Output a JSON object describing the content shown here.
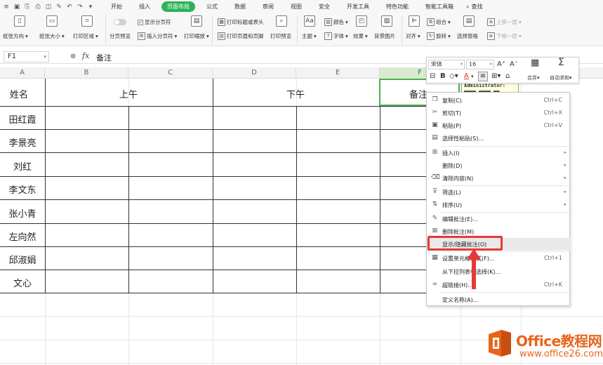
{
  "tabs": {
    "items": [
      "开始",
      "插入",
      "页面布局",
      "公式",
      "数据",
      "审阅",
      "视图",
      "安全",
      "开发工具",
      "特色功能",
      "智能工具箱"
    ],
    "active": "页面布局",
    "search_label": "查找"
  },
  "ribbon": {
    "paper_direction": "纸张方向",
    "paper_size": "纸张大小",
    "print_area": "打印区域",
    "page_break_preview": "分页预览",
    "show_page_break": "显示分页符",
    "insert_page_break": "插入分页符",
    "print_scale": "打印缩放",
    "print_titles": "打印标题或表头",
    "print_header_footer": "打印页眉和页脚",
    "print_preview": "打印预览",
    "theme": "主题",
    "color": "颜色",
    "font": "字体",
    "effect": "效果",
    "background_image": "背景图片",
    "align": "对齐",
    "group": "组合",
    "rotate": "旋转",
    "selection_pane": "选择窗格",
    "bring_forward": "上移一层",
    "send_backward": "下移一层"
  },
  "formula_bar": {
    "cell_ref": "F1",
    "fx": "fx",
    "content": "备注"
  },
  "columns": [
    "A",
    "B",
    "C",
    "D",
    "E",
    "F"
  ],
  "sheet": {
    "header_name": "姓名",
    "header_morning": "上午",
    "header_afternoon": "下午",
    "header_note": "备注",
    "names": [
      "田红霞",
      "李景亮",
      "刘红",
      "李文东",
      "张小青",
      "左向然",
      "邱淑娟",
      "文心"
    ]
  },
  "comment": {
    "author": "Administrator:"
  },
  "mini_toolbar": {
    "font_name": "宋体",
    "font_size": "16",
    "grow": "A⁺",
    "shrink": "A⁻",
    "merge": "合并",
    "autosum": "自动求和"
  },
  "context_menu": {
    "items": [
      {
        "label": "复制(C)",
        "shortcut": "Ctrl+C",
        "icon": "copy-icon"
      },
      {
        "label": "剪切(T)",
        "shortcut": "Ctrl+X",
        "icon": "cut-icon"
      },
      {
        "label": "粘贴(P)",
        "shortcut": "Ctrl+V",
        "icon": "paste-icon"
      },
      {
        "label": "选择性粘贴(S)...",
        "shortcut": "",
        "icon": "paste-special-icon"
      },
      {
        "label": "插入(I)",
        "shortcut": "",
        "icon": "insert-icon"
      },
      {
        "label": "删除(D)",
        "shortcut": "",
        "icon": ""
      },
      {
        "label": "清除内容(N)",
        "shortcut": "",
        "icon": "clear-icon"
      },
      {
        "label": "筛选(L)",
        "shortcut": "",
        "icon": "filter-icon"
      },
      {
        "label": "排序(U)",
        "shortcut": "",
        "icon": "sort-icon"
      },
      {
        "label": "编辑批注(E)...",
        "shortcut": "",
        "icon": "edit-comment-icon"
      },
      {
        "label": "删除批注(M)",
        "shortcut": "",
        "icon": "delete-comment-icon"
      },
      {
        "label": "显示/隐藏批注(O)",
        "shortcut": "",
        "icon": ""
      },
      {
        "label": "设置单元格格式(F)...",
        "shortcut": "Ctrl+1",
        "icon": "format-cells-icon"
      },
      {
        "label": "从下拉列表中选择(K)...",
        "shortcut": "",
        "icon": ""
      },
      {
        "label": "超链接(H)...",
        "shortcut": "Ctrl+K",
        "icon": "hyperlink-icon"
      },
      {
        "label": "定义名称(A)...",
        "shortcut": "",
        "icon": ""
      }
    ]
  },
  "watermark": {
    "title": "Office教程网",
    "url": "www.office26.com"
  },
  "colors": {
    "active_tab": "#2db357",
    "highlight_box": "#e53935",
    "logo": "#e8641b",
    "selection": "#4caf50"
  }
}
